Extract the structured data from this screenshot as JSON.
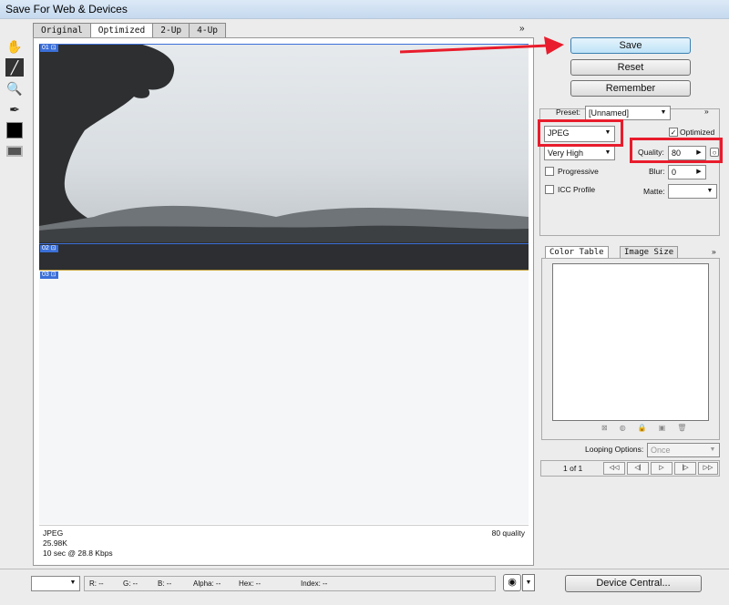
{
  "window": {
    "title": "Save For Web & Devices"
  },
  "tabs": [
    "Original",
    "Optimized",
    "2-Up",
    "4-Up"
  ],
  "slices": [
    "01 ⊡",
    "02 ⊡",
    "03 ⊡"
  ],
  "info": {
    "format": "JPEG",
    "size": "25.98K",
    "download": "10 sec @ 28.8 Kbps",
    "quality": "80 quality"
  },
  "buttons": {
    "save": "Save",
    "reset": "Reset",
    "remember": "Remember",
    "device_central": "Device Central..."
  },
  "settings": {
    "preset_label": "Preset:",
    "preset_value": "[Unnamed]",
    "format": "JPEG",
    "optimized_label": "Optimized",
    "compression_quality": "Very High",
    "quality_label": "Quality:",
    "quality_value": "80",
    "progressive_label": "Progressive",
    "blur_label": "Blur:",
    "blur_value": "0",
    "icc_label": "ICC Profile",
    "matte_label": "Matte:"
  },
  "color_panel": {
    "tabs": [
      "Color Table",
      "Image Size"
    ]
  },
  "animation": {
    "looping_label": "Looping Options:",
    "looping_value": "Once",
    "frame": "1 of 1"
  },
  "status": {
    "r": "R:  --",
    "g": "G:  --",
    "b": "B:  --",
    "alpha": "Alpha:  --",
    "hex": "Hex:  --",
    "index": "Index:  --"
  },
  "colors": {
    "annotation": "#e81c2c",
    "save_button": "#bfe3f7",
    "slice_border": "#3b6fd8"
  }
}
